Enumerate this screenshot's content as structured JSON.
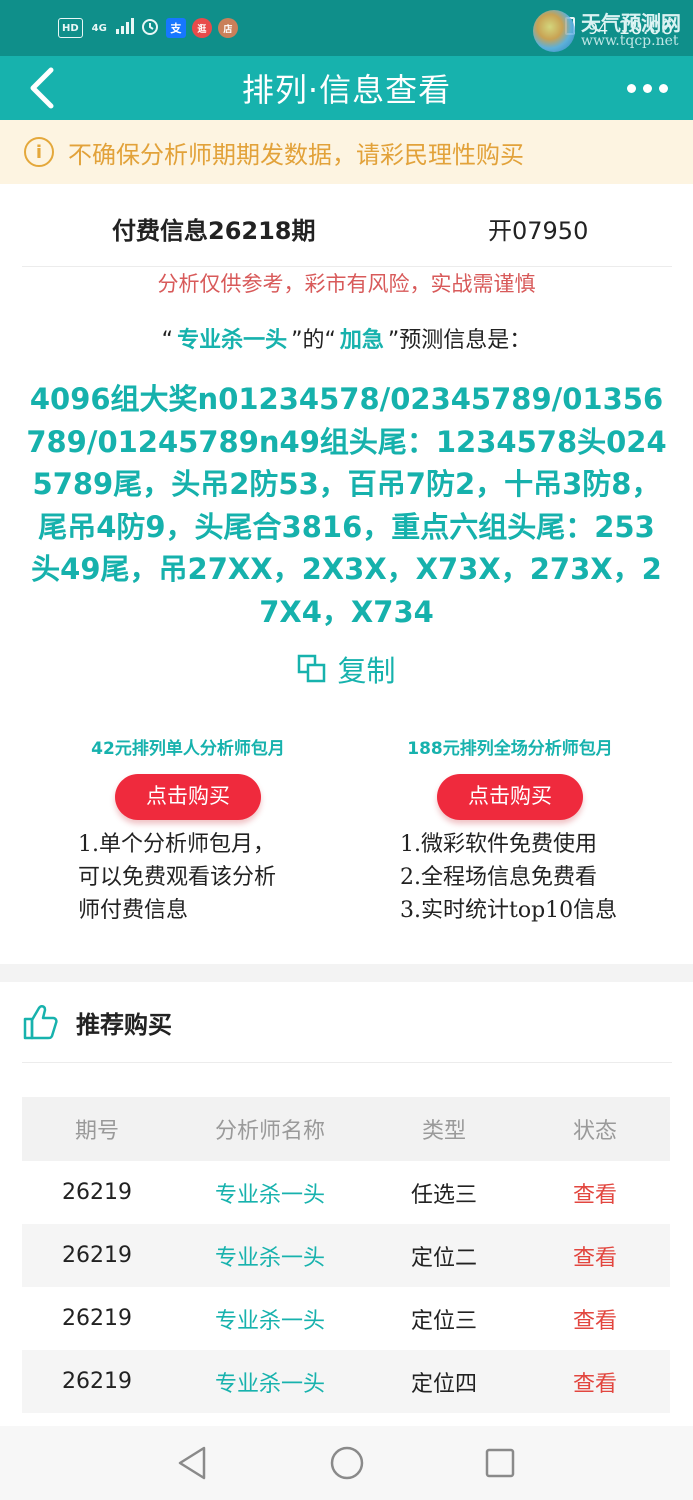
{
  "status_bar": {
    "left_items": [
      "HD",
      "4G",
      "闹钟",
      "支",
      "逛",
      "店"
    ],
    "battery_label": "94",
    "time": "10:06",
    "watermark_top": "天气预测网",
    "watermark_url": "www.tqcp.net"
  },
  "nav": {
    "title": "排列·信息查看"
  },
  "notice": {
    "text": "不确保分析师期期发数据，请彩民理性购买"
  },
  "info": {
    "issue_title": "付费信息26218期",
    "open_code": "开07950",
    "risk": "分析仅供参考，彩市有风险，实战需谨慎",
    "predict_prefix": "“",
    "analyst": "专业杀一头",
    "predict_mid": "”的“",
    "level": "加急",
    "predict_suffix": "”预测信息是：",
    "content": "4096组大奖n01234578/02345789/01356789/01245789n49组头尾：1234578头0245789尾，头吊2防53，百吊7防2，十吊3防8，尾吊4防9，头尾合3816，重点六组头尾：253头49尾，吊27XX，2X3X，X73X，273X，27X4，X734",
    "copy_label": "复制"
  },
  "packages": [
    {
      "title": "42元排列单人分析师包月",
      "button": "点击购买",
      "lines": [
        "1.单个分析师包月，",
        "可以免费观看该分析",
        "师付费信息"
      ]
    },
    {
      "title": "188元排列全场分析师包月",
      "button": "点击购买",
      "lines": [
        "1.微彩软件免费使用",
        "2.全程场信息免费看",
        "3.实时统计top10信息"
      ]
    }
  ],
  "recommend": {
    "title": "推荐购买",
    "columns": [
      "期号",
      "分析师名称",
      "类型",
      "状态"
    ],
    "rows": [
      {
        "issue": "26219",
        "analyst": "专业杀一头",
        "type": "任选三",
        "status": "查看"
      },
      {
        "issue": "26219",
        "analyst": "专业杀一头",
        "type": "定位二",
        "status": "查看"
      },
      {
        "issue": "26219",
        "analyst": "专业杀一头",
        "type": "定位三",
        "status": "查看"
      },
      {
        "issue": "26219",
        "analyst": "专业杀一头",
        "type": "定位四",
        "status": "查看"
      }
    ]
  },
  "colors": {
    "status_bar": "#0f8f8a",
    "nav_bar": "#17b2ad",
    "accent": "#17b2ad",
    "notice_bg": "#fdf4e1",
    "notice_text": "#e2a23a",
    "risk_text": "#d85a5a",
    "buy_button": "#ef2a3d",
    "view_link": "#e2463f"
  },
  "icons": {
    "back": "chevron-left-icon",
    "more": "more-dots-icon",
    "notice": "info-circle-icon",
    "copy": "copy-icon",
    "recommend": "thumbs-up-icon",
    "sys_back": "triangle-back-icon",
    "sys_home": "circle-home-icon",
    "sys_recent": "square-recent-icon"
  }
}
